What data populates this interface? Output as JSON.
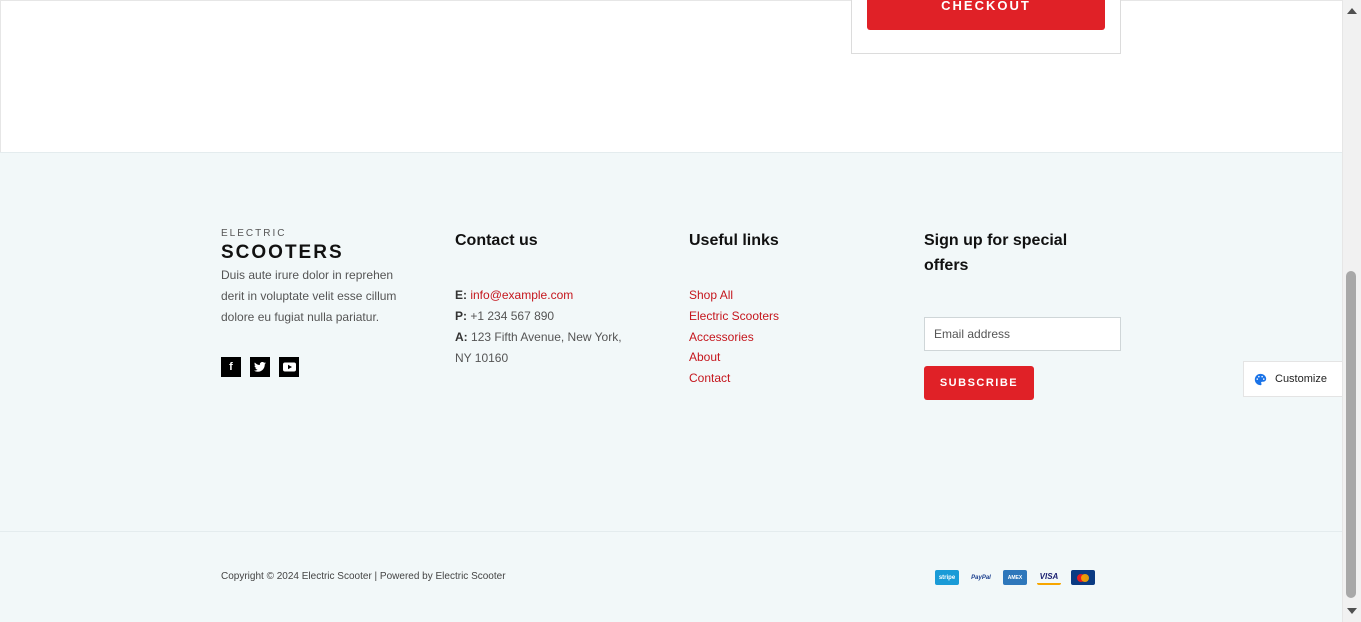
{
  "cart": {
    "checkout_label": "CHECKOUT"
  },
  "brand": {
    "small": "ELECTRIC",
    "big": "SCOOTERS",
    "description": "Duis aute irure dolor in reprehen derit in voluptate velit esse cillum dolore eu fugiat nulla pariatur."
  },
  "socials": [
    {
      "icon": "facebook-icon",
      "glyph": "f"
    },
    {
      "icon": "twitter-icon",
      "glyph": "t"
    },
    {
      "icon": "youtube-icon",
      "glyph": "▶"
    }
  ],
  "contact": {
    "heading": "Contact us",
    "email_label": "E:",
    "email": "info@example.com",
    "phone_label": "P:",
    "phone": "+1 234 567 890",
    "address_label": "A:",
    "address": "123 Fifth Avenue, New York, NY 10160"
  },
  "links": {
    "heading": "Useful links",
    "items": [
      "Shop All",
      "Electric Scooters",
      "Accessories",
      "About",
      "Contact"
    ]
  },
  "signup": {
    "heading": "Sign up for special offers",
    "email_placeholder": "Email address",
    "subscribe_label": "SUBSCRIBE"
  },
  "bottom": {
    "copyright": "Copyright © 2024 Electric Scooter | Powered by Electric Scooter",
    "payments": [
      {
        "name": "stripe",
        "label": "stripe",
        "color": "#1a9bd7"
      },
      {
        "name": "paypal",
        "label": "PayPal",
        "color": "#f2f8f9"
      },
      {
        "name": "amex",
        "label": "AMEX",
        "color": "#2e77bb"
      },
      {
        "name": "visa",
        "label": "VISA",
        "color": "#f2f8f9"
      },
      {
        "name": "mastercard",
        "label": "MC",
        "color": "#0a3a82"
      }
    ]
  },
  "customize": {
    "label": "Customize"
  },
  "colors": {
    "accent": "#e02127",
    "link": "#c5161d",
    "footer_bg": "#f2f8f9"
  }
}
